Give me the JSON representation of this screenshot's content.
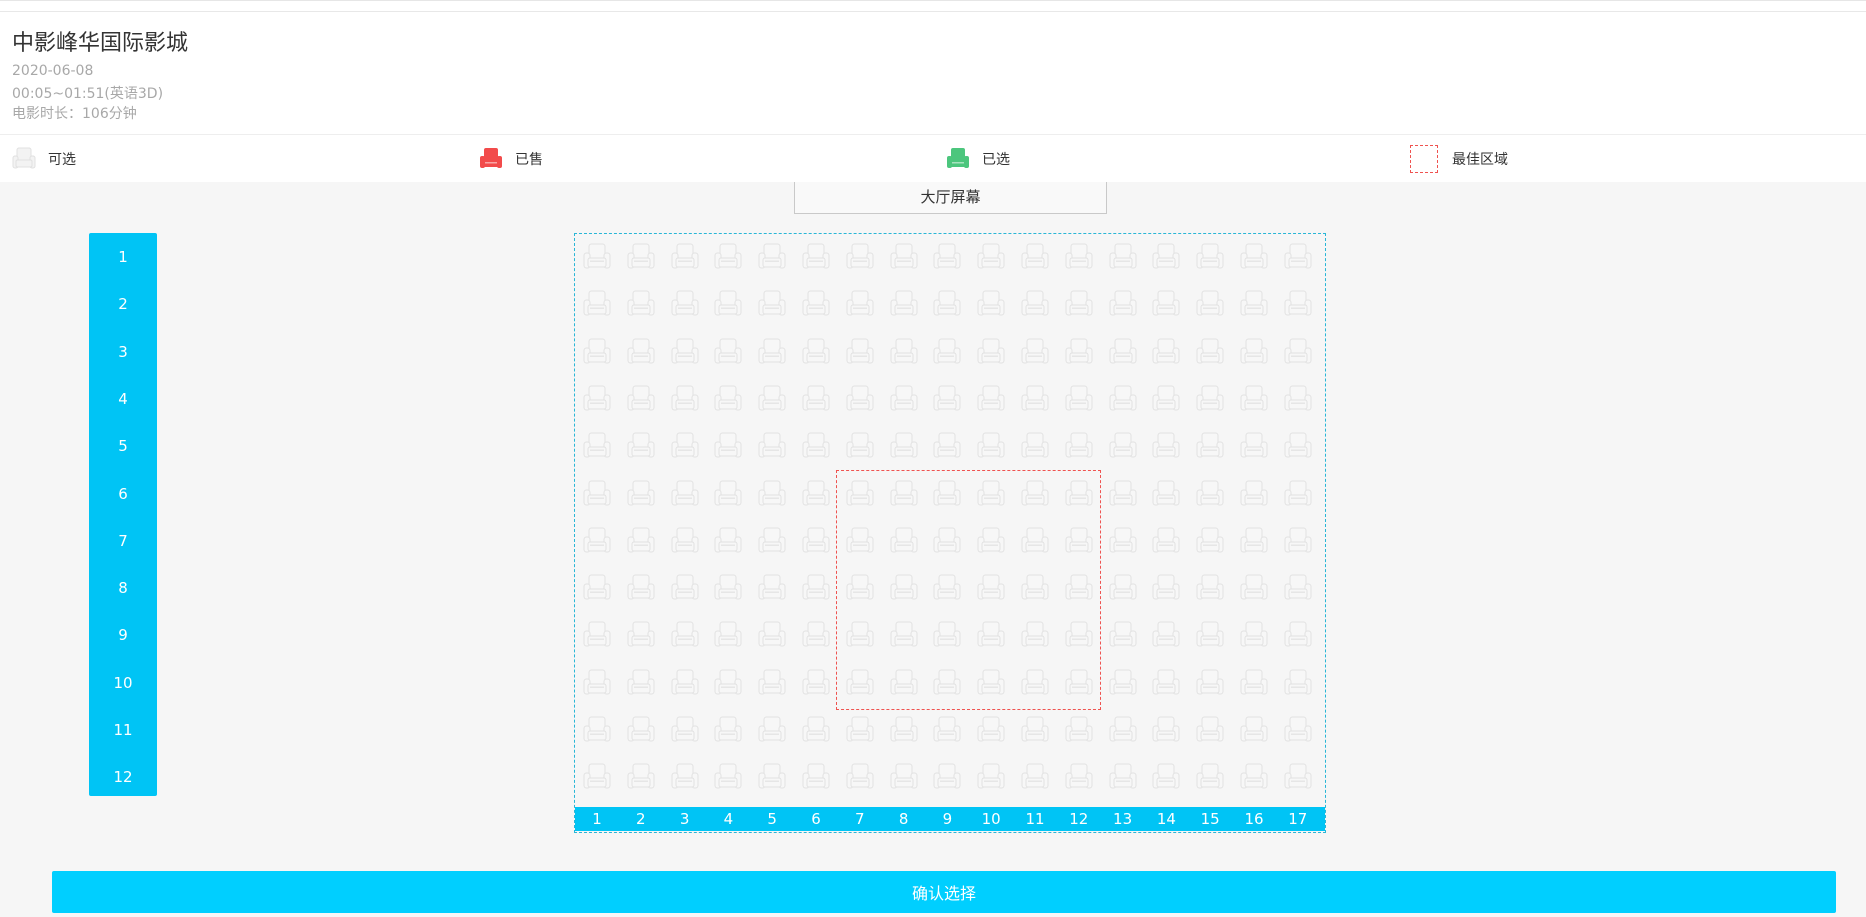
{
  "cinema": {
    "name": "中影峰华国际影城",
    "date": "2020-06-08",
    "time": "00:05~01:51(英语3D)",
    "duration": "电影时长：106分钟"
  },
  "legend": {
    "available": "可选",
    "sold": "已售",
    "selected": "已选",
    "best": "最佳区域"
  },
  "screen_label": "大厅屏幕",
  "rows": [
    "1",
    "2",
    "3",
    "4",
    "5",
    "6",
    "7",
    "8",
    "9",
    "10",
    "11",
    "12"
  ],
  "columns": [
    "1",
    "2",
    "3",
    "4",
    "5",
    "6",
    "7",
    "8",
    "9",
    "10",
    "11",
    "12",
    "13",
    "14",
    "15",
    "16",
    "17"
  ],
  "best_zone": {
    "rows": [
      6,
      10
    ],
    "columns": [
      7,
      12
    ]
  },
  "colors": {
    "accent": "#00c4f5",
    "sold": "#f24b4b",
    "selected": "#4cc67d",
    "available": "#d9d9d9",
    "best_border": "#ef5350"
  },
  "icons": {
    "available": "seat-available-icon",
    "sold": "seat-sold-icon",
    "selected": "seat-selected-icon",
    "best": "best-area-icon"
  },
  "confirm_label": "确认选择"
}
